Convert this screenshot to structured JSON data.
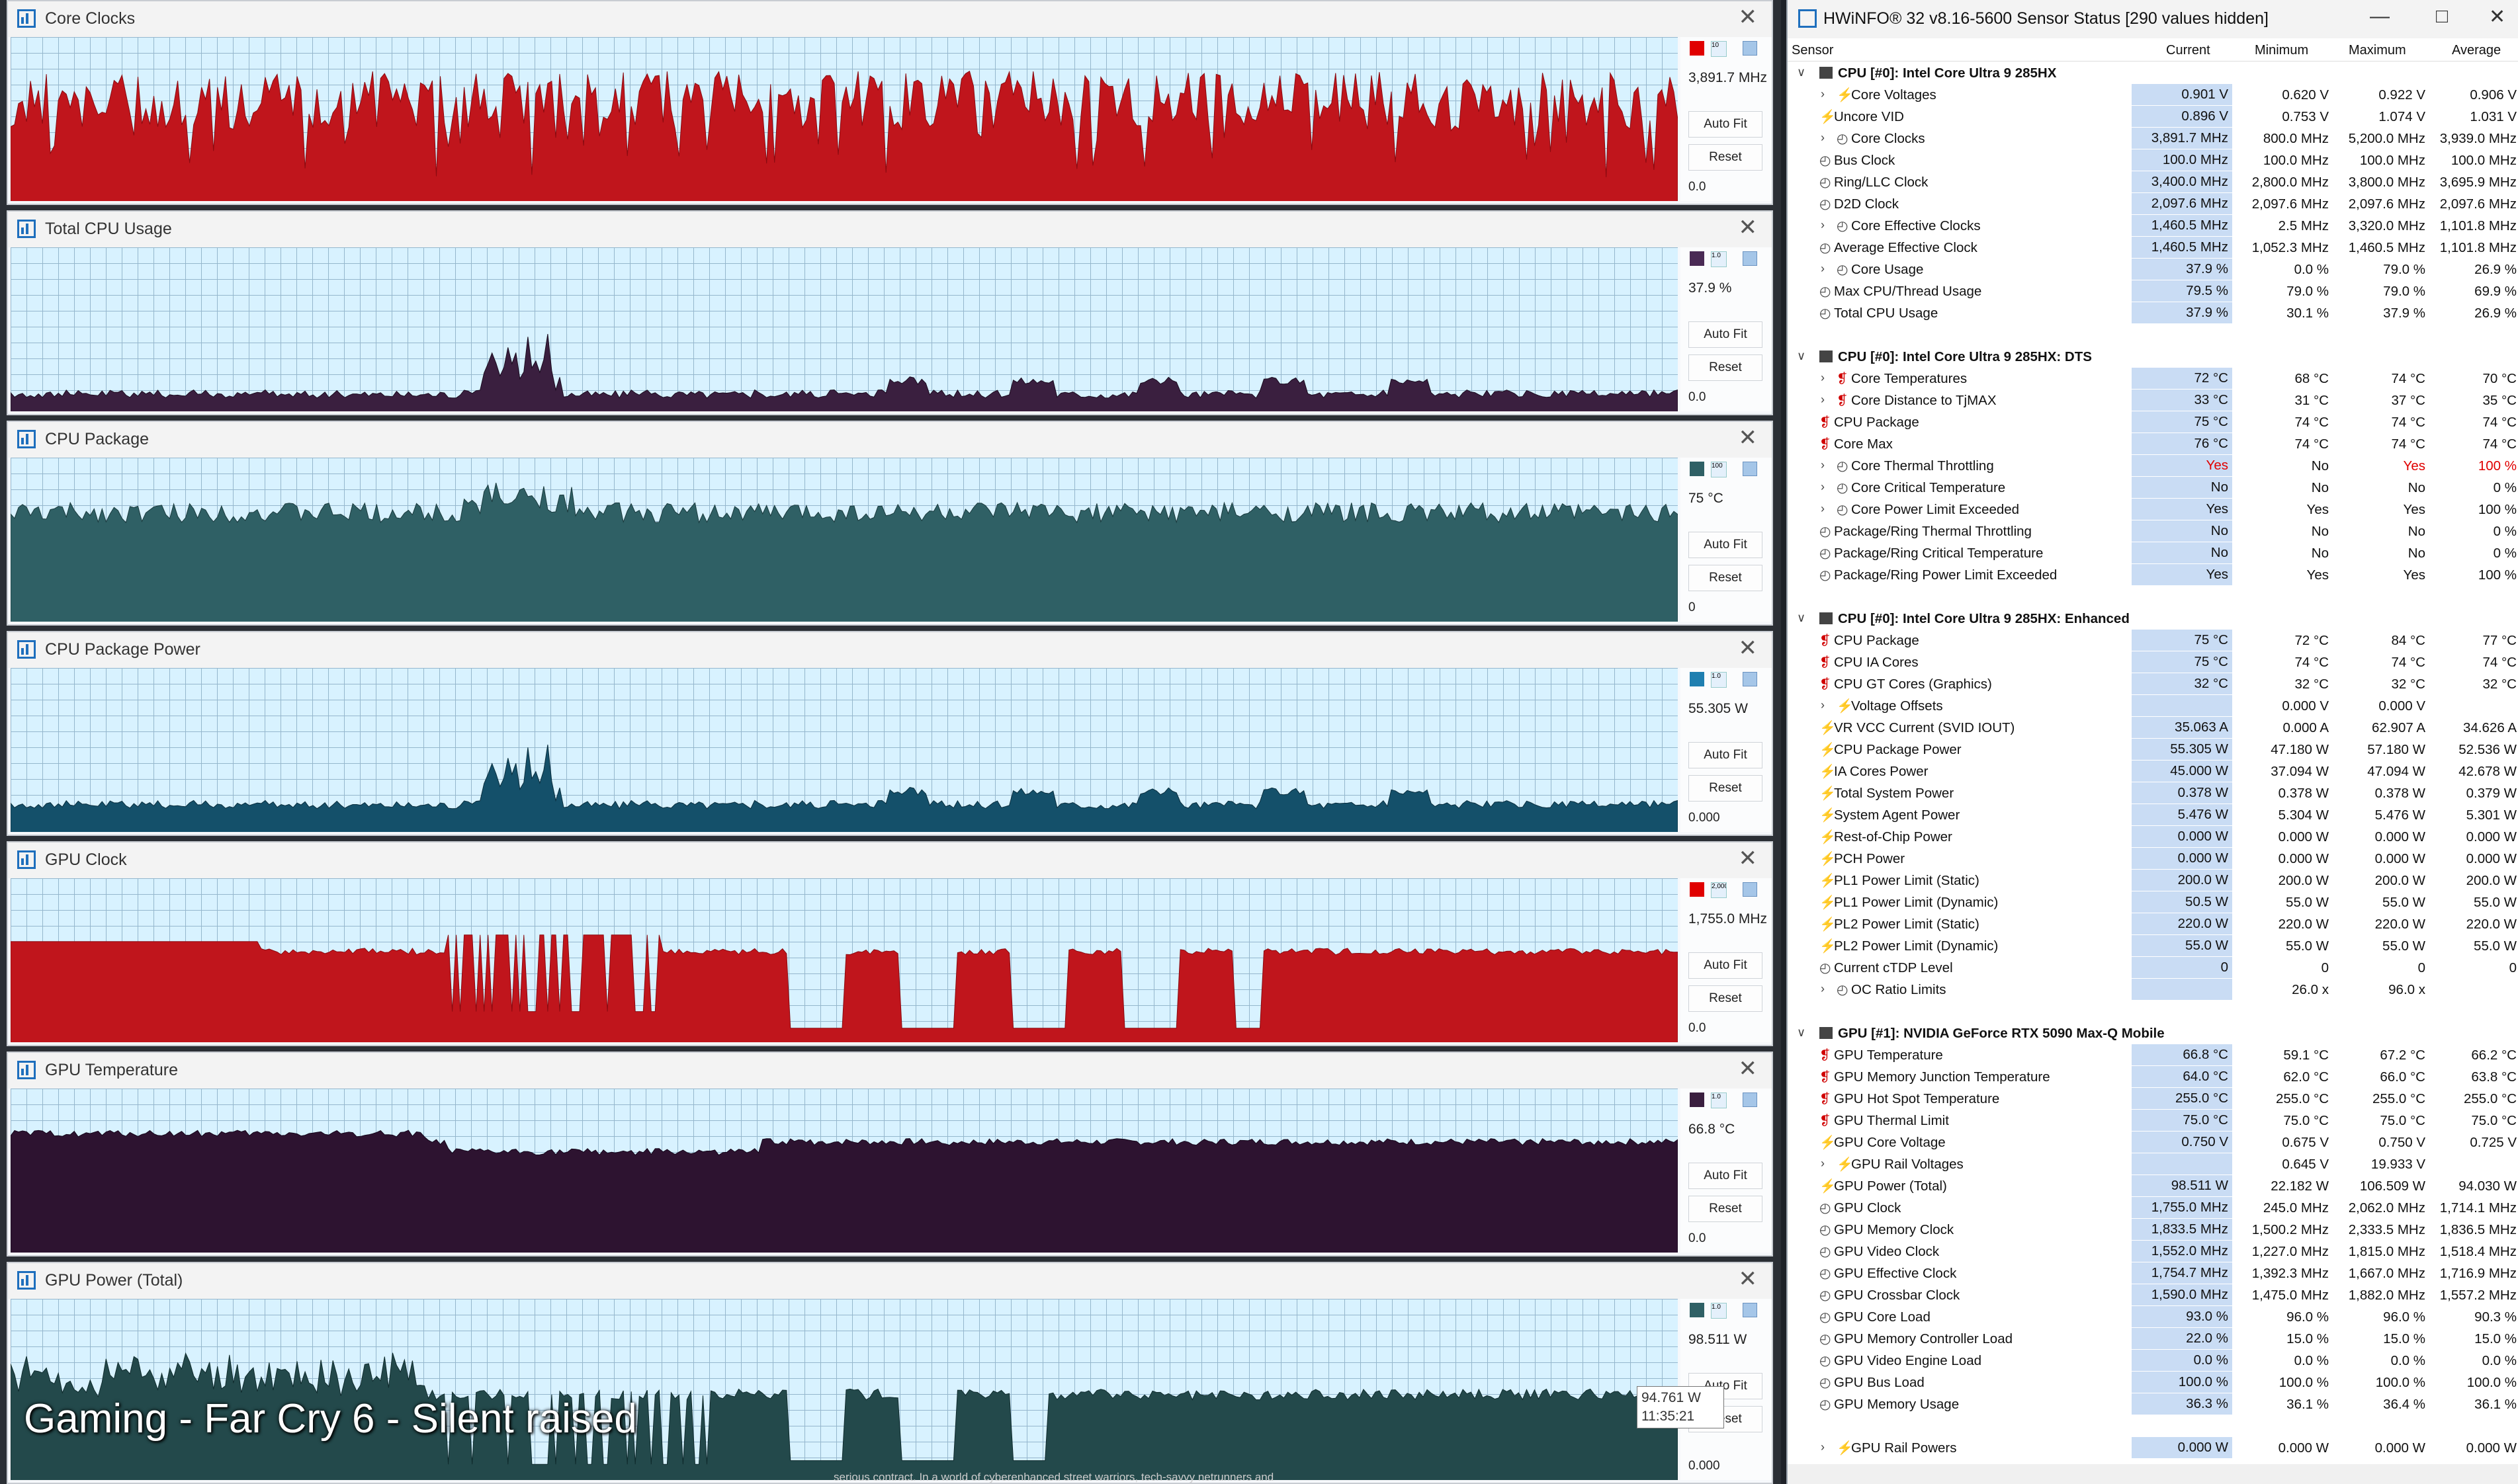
{
  "graphs": [
    {
      "title": "Core Clocks",
      "value": "3,891.7 MHz",
      "min": "0.0",
      "fill": "#c0151c",
      "stroke": "#8a0a10",
      "swatch": "#e00000",
      "swatch_text": "10",
      "profile": "clocks",
      "level": 0.62
    },
    {
      "title": "Total CPU Usage",
      "value": "37.9 %",
      "min": "0.0",
      "fill": "#3a1f3f",
      "stroke": "#1a0b1e",
      "swatch": "#4a2a55",
      "swatch_text": "1.0",
      "profile": "usage",
      "level": 0.12
    },
    {
      "title": "CPU Package",
      "value": "75 °C",
      "min": "0",
      "fill": "#2f6065",
      "stroke": "#1a3a3d",
      "swatch": "#2f6065",
      "swatch_text": "100",
      "profile": "temp",
      "level": 0.67
    },
    {
      "title": "CPU Package Power",
      "value": "55.305 W",
      "min": "0.000",
      "fill": "#14506a",
      "stroke": "#0a2e3d",
      "swatch": "#1f7fb0",
      "swatch_text": "1.0",
      "profile": "usage",
      "level": 0.18
    },
    {
      "title": "GPU Clock",
      "value": "1,755.0 MHz",
      "min": "0.0",
      "fill": "#c0151c",
      "stroke": "#8a0a10",
      "swatch": "#e00000",
      "swatch_text": "2,000.0",
      "profile": "gpuclock",
      "level": 0.56
    },
    {
      "title": "GPU Temperature",
      "value": "66.8 °C",
      "min": "0.0",
      "fill": "#2d1330",
      "stroke": "#14061a",
      "swatch": "#3a1f3f",
      "swatch_text": "1.0",
      "profile": "gputemp",
      "level": 0.68
    },
    {
      "title": "GPU Power (Total)",
      "value": "98.511 W",
      "min": "0.000",
      "fill": "#23494b",
      "stroke": "#0f2b2d",
      "swatch": "#2f6065",
      "swatch_text": "1.0",
      "profile": "gpupower",
      "level": 0.48
    }
  ],
  "buttons": {
    "autofit": "Auto Fit",
    "reset": "Reset"
  },
  "overlay": "Gaming - Far Cry 6 - Silent raised",
  "tooltip": {
    "value": "94.761 W",
    "time": "11:35:21"
  },
  "bottom_text": "serious contract. In a world of cyberenhanced street warriors, tech-savvy netrunners and",
  "hwinfo": {
    "title": "HWiNFO® 32 v8.16-5600 Sensor Status [290 values hidden]",
    "headers": {
      "sensor": "Sensor",
      "current": "Current",
      "minimum": "Minimum",
      "maximum": "Maximum",
      "average": "Average"
    },
    "rows": [
      {
        "g": 1,
        "name": "CPU [#0]: Intel Core Ultra 9 285HX"
      },
      {
        "e": 1,
        "i": "bolt",
        "name": "Core Voltages",
        "cur": "0.901 V",
        "min": "0.620 V",
        "max": "0.922 V",
        "avg": "0.906 V"
      },
      {
        "i": "bolt",
        "name": "Uncore VID",
        "cur": "0.896 V",
        "min": "0.753 V",
        "max": "1.074 V",
        "avg": "1.031 V"
      },
      {
        "e": 1,
        "i": "clock",
        "name": "Core Clocks",
        "cur": "3,891.7 MHz",
        "min": "800.0 MHz",
        "max": "5,200.0 MHz",
        "avg": "3,939.0 MHz"
      },
      {
        "i": "clock",
        "name": "Bus Clock",
        "cur": "100.0 MHz",
        "min": "100.0 MHz",
        "max": "100.0 MHz",
        "avg": "100.0 MHz"
      },
      {
        "i": "clock",
        "name": "Ring/LLC Clock",
        "cur": "3,400.0 MHz",
        "min": "2,800.0 MHz",
        "max": "3,800.0 MHz",
        "avg": "3,695.9 MHz"
      },
      {
        "i": "clock",
        "name": "D2D Clock",
        "cur": "2,097.6 MHz",
        "min": "2,097.6 MHz",
        "max": "2,097.6 MHz",
        "avg": "2,097.6 MHz"
      },
      {
        "e": 1,
        "i": "clock",
        "name": "Core Effective Clocks",
        "cur": "1,460.5 MHz",
        "min": "2.5 MHz",
        "max": "3,320.0 MHz",
        "avg": "1,101.8 MHz"
      },
      {
        "i": "clock",
        "name": "Average Effective Clock",
        "cur": "1,460.5 MHz",
        "min": "1,052.3 MHz",
        "max": "1,460.5 MHz",
        "avg": "1,101.8 MHz"
      },
      {
        "e": 1,
        "i": "clock",
        "name": "Core Usage",
        "cur": "37.9 %",
        "min": "0.0 %",
        "max": "79.0 %",
        "avg": "26.9 %"
      },
      {
        "i": "clock",
        "name": "Max CPU/Thread Usage",
        "cur": "79.5 %",
        "min": "79.0 %",
        "max": "79.0 %",
        "avg": "69.9 %"
      },
      {
        "i": "clock",
        "name": "Total CPU Usage",
        "cur": "37.9 %",
        "min": "30.1 %",
        "max": "37.9 %",
        "avg": "26.9 %"
      },
      {
        "blank": 1
      },
      {
        "g": 1,
        "name": "CPU [#0]: Intel Core Ultra 9 285HX: DTS"
      },
      {
        "e": 1,
        "i": "temp",
        "name": "Core Temperatures",
        "cur": "72 °C",
        "min": "68 °C",
        "max": "74 °C",
        "avg": "70 °C"
      },
      {
        "e": 1,
        "i": "temp",
        "name": "Core Distance to TjMAX",
        "cur": "33 °C",
        "min": "31 °C",
        "max": "37 °C",
        "avg": "35 °C"
      },
      {
        "i": "temp",
        "name": "CPU Package",
        "cur": "75 °C",
        "min": "74 °C",
        "max": "74 °C",
        "avg": "74 °C"
      },
      {
        "i": "temp",
        "name": "Core Max",
        "cur": "76 °C",
        "min": "74 °C",
        "max": "74 °C",
        "avg": "74 °C"
      },
      {
        "e": 1,
        "i": "clock",
        "name": "Core Thermal Throttling",
        "cur": "Yes",
        "min": "No",
        "max": "Yes",
        "avg": "100 %",
        "red": 1
      },
      {
        "e": 1,
        "i": "clock",
        "name": "Core Critical Temperature",
        "cur": "No",
        "min": "No",
        "max": "No",
        "avg": "0 %"
      },
      {
        "e": 1,
        "i": "clock",
        "name": "Core Power Limit Exceeded",
        "cur": "Yes",
        "min": "Yes",
        "max": "Yes",
        "avg": "100 %"
      },
      {
        "i": "clock",
        "name": "Package/Ring Thermal Throttling",
        "cur": "No",
        "min": "No",
        "max": "No",
        "avg": "0 %"
      },
      {
        "i": "clock",
        "name": "Package/Ring Critical Temperature",
        "cur": "No",
        "min": "No",
        "max": "No",
        "avg": "0 %"
      },
      {
        "i": "clock",
        "name": "Package/Ring Power Limit Exceeded",
        "cur": "Yes",
        "min": "Yes",
        "max": "Yes",
        "avg": "100 %"
      },
      {
        "blank": 1
      },
      {
        "g": 1,
        "name": "CPU [#0]: Intel Core Ultra 9 285HX: Enhanced"
      },
      {
        "i": "temp",
        "name": "CPU Package",
        "cur": "75 °C",
        "min": "72 °C",
        "max": "84 °C",
        "avg": "77 °C"
      },
      {
        "i": "temp",
        "name": "CPU IA Cores",
        "cur": "75 °C",
        "min": "74 °C",
        "max": "74 °C",
        "avg": "74 °C"
      },
      {
        "i": "temp",
        "name": "CPU GT Cores (Graphics)",
        "cur": "32 °C",
        "min": "32 °C",
        "max": "32 °C",
        "avg": "32 °C"
      },
      {
        "e": 1,
        "i": "bolt",
        "name": "Voltage Offsets",
        "cur": "",
        "min": "0.000 V",
        "max": "0.000 V",
        "avg": ""
      },
      {
        "i": "bolt",
        "name": "VR VCC Current (SVID IOUT)",
        "cur": "35.063 A",
        "min": "0.000 A",
        "max": "62.907 A",
        "avg": "34.626 A"
      },
      {
        "i": "bolt",
        "name": "CPU Package Power",
        "cur": "55.305 W",
        "min": "47.180 W",
        "max": "57.180 W",
        "avg": "52.536 W"
      },
      {
        "i": "bolt",
        "name": "IA Cores Power",
        "cur": "45.000 W",
        "min": "37.094 W",
        "max": "47.094 W",
        "avg": "42.678 W"
      },
      {
        "i": "bolt",
        "name": "Total System Power",
        "cur": "0.378 W",
        "min": "0.378 W",
        "max": "0.378 W",
        "avg": "0.379 W"
      },
      {
        "i": "bolt",
        "name": "System Agent Power",
        "cur": "5.476 W",
        "min": "5.304 W",
        "max": "5.476 W",
        "avg": "5.301 W"
      },
      {
        "i": "bolt",
        "name": "Rest-of-Chip Power",
        "cur": "0.000 W",
        "min": "0.000 W",
        "max": "0.000 W",
        "avg": "0.000 W"
      },
      {
        "i": "bolt",
        "name": "PCH Power",
        "cur": "0.000 W",
        "min": "0.000 W",
        "max": "0.000 W",
        "avg": "0.000 W"
      },
      {
        "i": "bolt",
        "name": "PL1 Power Limit (Static)",
        "cur": "200.0 W",
        "min": "200.0 W",
        "max": "200.0 W",
        "avg": "200.0 W"
      },
      {
        "i": "bolt",
        "name": "PL1 Power Limit (Dynamic)",
        "cur": "50.5 W",
        "min": "55.0 W",
        "max": "55.0 W",
        "avg": "55.0 W"
      },
      {
        "i": "bolt",
        "name": "PL2 Power Limit (Static)",
        "cur": "220.0 W",
        "min": "220.0 W",
        "max": "220.0 W",
        "avg": "220.0 W"
      },
      {
        "i": "bolt",
        "name": "PL2 Power Limit (Dynamic)",
        "cur": "55.0 W",
        "min": "55.0 W",
        "max": "55.0 W",
        "avg": "55.0 W"
      },
      {
        "i": "clock",
        "name": "Current cTDP Level",
        "cur": "0",
        "min": "0",
        "max": "0",
        "avg": "0"
      },
      {
        "e": 1,
        "i": "clock",
        "name": "OC Ratio Limits",
        "cur": "",
        "min": "26.0 x",
        "max": "96.0 x",
        "avg": ""
      },
      {
        "blank": 1
      },
      {
        "g": 1,
        "name": "GPU [#1]: NVIDIA  GeForce RTX 5090 Max-Q Mobile"
      },
      {
        "i": "temp",
        "name": "GPU Temperature",
        "cur": "66.8 °C",
        "min": "59.1 °C",
        "max": "67.2 °C",
        "avg": "66.2 °C"
      },
      {
        "i": "temp",
        "name": "GPU Memory Junction Temperature",
        "cur": "64.0 °C",
        "min": "62.0 °C",
        "max": "66.0 °C",
        "avg": "63.8 °C"
      },
      {
        "i": "temp",
        "name": "GPU Hot Spot Temperature",
        "cur": "255.0 °C",
        "min": "255.0 °C",
        "max": "255.0 °C",
        "avg": "255.0 °C"
      },
      {
        "i": "temp",
        "name": "GPU Thermal Limit",
        "cur": "75.0 °C",
        "min": "75.0 °C",
        "max": "75.0 °C",
        "avg": "75.0 °C"
      },
      {
        "i": "bolt",
        "name": "GPU Core Voltage",
        "cur": "0.750 V",
        "min": "0.675 V",
        "max": "0.750 V",
        "avg": "0.725 V"
      },
      {
        "e": 1,
        "i": "bolt",
        "name": "GPU Rail Voltages",
        "cur": "",
        "min": "0.645 V",
        "max": "19.933 V",
        "avg": ""
      },
      {
        "i": "bolt",
        "name": "GPU Power (Total)",
        "cur": "98.511 W",
        "min": "22.182 W",
        "max": "106.509 W",
        "avg": "94.030 W"
      },
      {
        "i": "clock",
        "name": "GPU Clock",
        "cur": "1,755.0 MHz",
        "min": "245.0 MHz",
        "max": "2,062.0 MHz",
        "avg": "1,714.1 MHz"
      },
      {
        "i": "clock",
        "name": "GPU Memory Clock",
        "cur": "1,833.5 MHz",
        "min": "1,500.2 MHz",
        "max": "2,333.5 MHz",
        "avg": "1,836.5 MHz"
      },
      {
        "i": "clock",
        "name": "GPU Video Clock",
        "cur": "1,552.0 MHz",
        "min": "1,227.0 MHz",
        "max": "1,815.0 MHz",
        "avg": "1,518.4 MHz"
      },
      {
        "i": "clock",
        "name": "GPU Effective Clock",
        "cur": "1,754.7 MHz",
        "min": "1,392.3 MHz",
        "max": "1,667.0 MHz",
        "avg": "1,716.9 MHz"
      },
      {
        "i": "clock",
        "name": "GPU Crossbar Clock",
        "cur": "1,590.0 MHz",
        "min": "1,475.0 MHz",
        "max": "1,882.0 MHz",
        "avg": "1,557.2 MHz"
      },
      {
        "i": "clock",
        "name": "GPU Core Load",
        "cur": "93.0 %",
        "min": "96.0 %",
        "max": "96.0 %",
        "avg": "90.3 %"
      },
      {
        "i": "clock",
        "name": "GPU Memory Controller Load",
        "cur": "22.0 %",
        "min": "15.0 %",
        "max": "15.0 %",
        "avg": "15.0 %"
      },
      {
        "i": "clock",
        "name": "GPU Video Engine Load",
        "cur": "0.0 %",
        "min": "0.0 %",
        "max": "0.0 %",
        "avg": "0.0 %"
      },
      {
        "i": "clock",
        "name": "GPU Bus Load",
        "cur": "100.0 %",
        "min": "100.0 %",
        "max": "100.0 %",
        "avg": "100.0 %"
      },
      {
        "i": "clock",
        "name": "GPU Memory Usage",
        "cur": "36.3 %",
        "min": "36.1 %",
        "max": "36.4 %",
        "avg": "36.1 %"
      },
      {
        "blank": 1
      },
      {
        "e": 1,
        "i": "bolt",
        "name": "GPU Rail Powers",
        "cur": "0.000 W",
        "min": "0.000 W",
        "max": "0.000 W",
        "avg": "0.000 W"
      }
    ]
  }
}
